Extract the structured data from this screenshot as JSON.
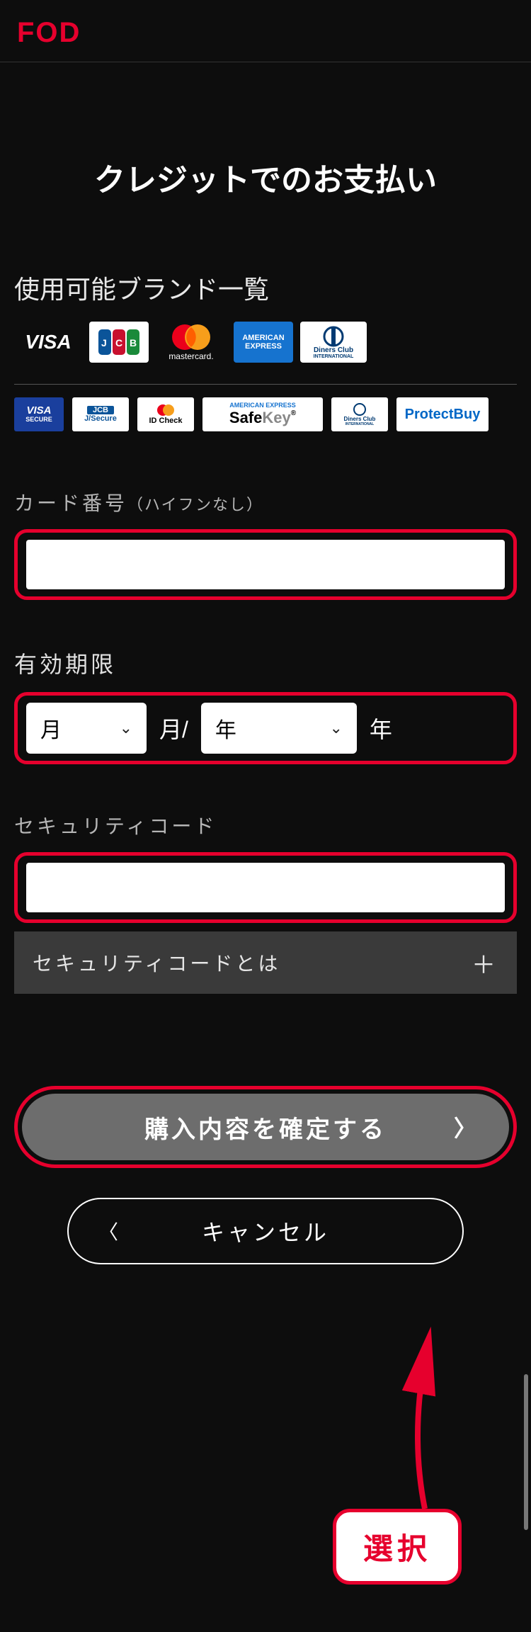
{
  "header": {
    "logo": "FOD"
  },
  "title": "クレジットでのお支払い",
  "brands": {
    "heading": "使用可能ブランド一覧",
    "list": [
      "VISA",
      "JCB",
      "mastercard.",
      "AMERICAN EXPRESS",
      "Diners Club INTERNATIONAL"
    ],
    "secure": {
      "visa": "VISA SECURE",
      "jcb_top": "JCB",
      "jcb_bottom": "J/Secure",
      "mc_top": "●●",
      "mc_bottom": "ID Check",
      "amex_top": "AMERICAN EXPRESS",
      "amex_safekey_a": "Safe",
      "amex_safekey_b": "Key",
      "diners_top": "Diners Club",
      "diners_bottom": "INTERNATIONAL",
      "protect": "ProtectBuy"
    }
  },
  "form": {
    "card_label_a": "カード番号",
    "card_label_b": "（ハイフンなし）",
    "card_value": "",
    "expiry_label": "有効期限",
    "month_placeholder": "月",
    "month_unit": "月/",
    "year_placeholder": "年",
    "year_unit": "年",
    "cvv_label": "セキュリティコード",
    "cvv_value": "",
    "cvv_help": "セキュリティコードとは",
    "cvv_help_icon": "＋"
  },
  "buttons": {
    "confirm": "購入内容を確定する",
    "cancel": "キャンセル"
  },
  "annotation": {
    "pill": "選択"
  },
  "colors": {
    "brand_red": "#e6002d",
    "bg": "#0d0d0d"
  }
}
